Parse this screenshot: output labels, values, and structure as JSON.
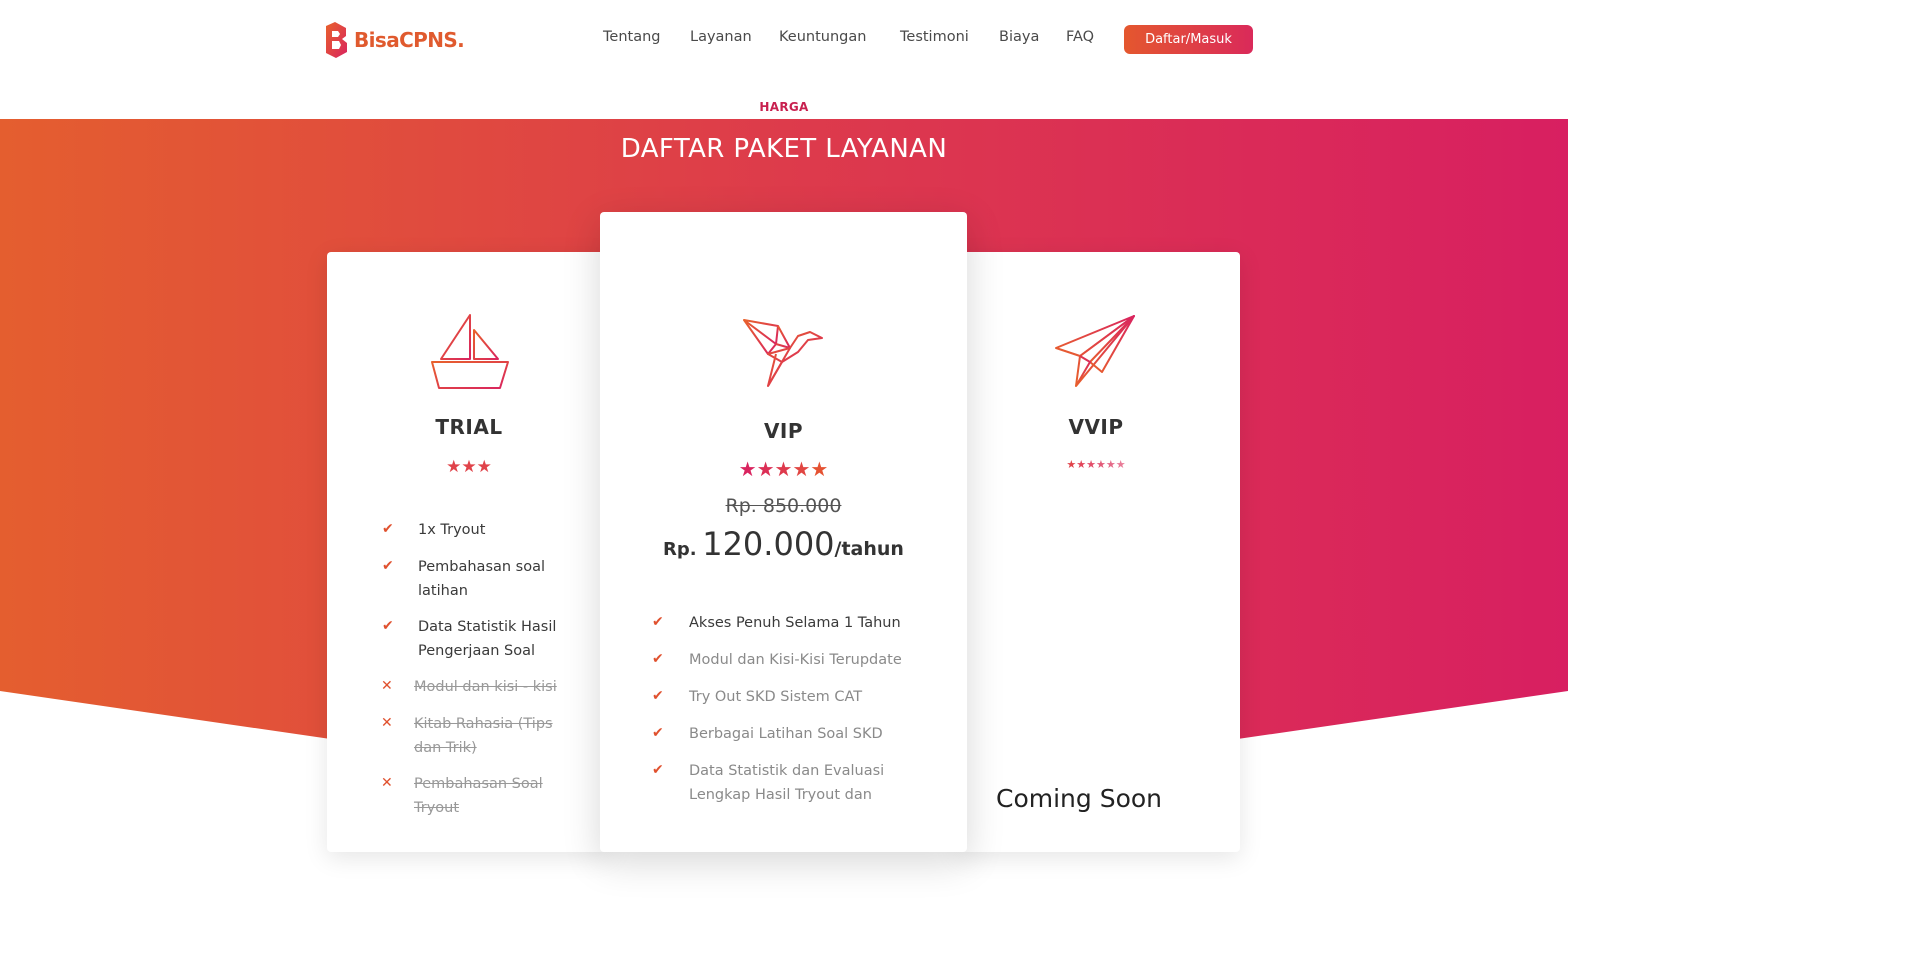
{
  "brand": {
    "name": "BisaCPNS."
  },
  "nav": {
    "items": [
      {
        "label": "Tentang"
      },
      {
        "label": "Layanan"
      },
      {
        "label": "Keuntungan"
      },
      {
        "label": "Testimoni"
      },
      {
        "label": "Biaya"
      },
      {
        "label": "FAQ"
      }
    ],
    "cta_label": "Daftar/Masuk"
  },
  "section": {
    "eyebrow": "HARGA",
    "title": "DAFTAR PAKET LAYANAN"
  },
  "plans": {
    "trial": {
      "name": "TRIAL",
      "icon": "sailboat-icon",
      "rating": 3,
      "features": [
        {
          "text": "1x Tryout",
          "included": true
        },
        {
          "text": "Pembahasan soal latihan",
          "included": true
        },
        {
          "text": "Data Statistik Hasil Pengerjaan Soal",
          "included": true
        },
        {
          "text": "Modul dan kisi - kisi",
          "included": false
        },
        {
          "text": "Kitab Rahasia (Tips dan Trik)",
          "included": false
        },
        {
          "text": "Pembahasan Soal Tryout",
          "included": false
        }
      ]
    },
    "vip": {
      "name": "VIP",
      "icon": "origami-bird-icon",
      "rating": 5,
      "old_price": "Rp. 850.000",
      "price_currency": "Rp.",
      "price_amount": "120.000",
      "price_period": "/tahun",
      "features": [
        {
          "text": "Akses Penuh Selama 1 Tahun",
          "included": true
        },
        {
          "text": "Modul dan Kisi-Kisi Terupdate",
          "included": true
        },
        {
          "text": "Try Out SKD Sistem CAT",
          "included": true
        },
        {
          "text": "Berbagai Latihan Soal SKD",
          "included": true
        },
        {
          "text": "Data Statistik dan Evaluasi Lengkap Hasil Tryout dan",
          "included": true
        }
      ]
    },
    "vvip": {
      "name": "VVIP",
      "icon": "paper-plane-icon",
      "rating": 6,
      "coming_soon": "Coming Soon"
    }
  },
  "colors": {
    "accent_orange": "#e4572e",
    "accent_pink": "#da2a5a",
    "gradient_left": "#e45e2f",
    "gradient_right": "#d81f61"
  }
}
